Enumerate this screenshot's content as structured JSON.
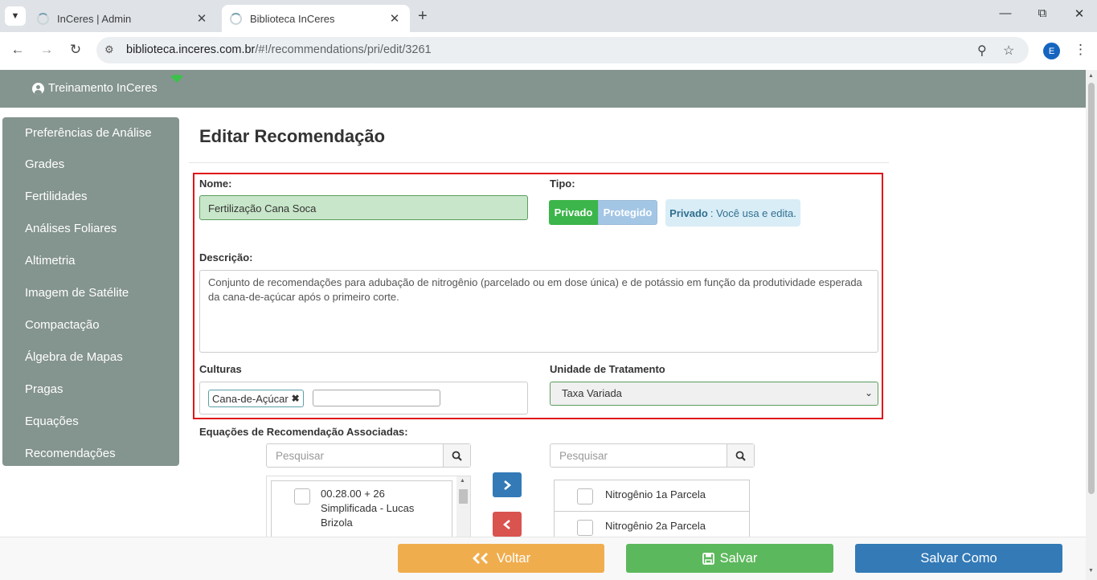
{
  "browser": {
    "tabs": [
      {
        "title": "InCeres | Admin",
        "active": false
      },
      {
        "title": "Biblioteca InCeres",
        "active": true
      }
    ],
    "url_host": "biblioteca.inceres.com.br",
    "url_path": "/#!/recommendations/pri/edit/3261",
    "profile_initial": "E"
  },
  "header": {
    "user_name": "Treinamento InCeres"
  },
  "sidebar": {
    "items": [
      {
        "label": "Preferências de Análise"
      },
      {
        "label": "Grades"
      },
      {
        "label": "Fertilidades"
      },
      {
        "label": "Análises Foliares"
      },
      {
        "label": "Altimetria"
      },
      {
        "label": "Imagem de Satélite"
      },
      {
        "label": "Compactação"
      },
      {
        "label": "Álgebra de Mapas"
      },
      {
        "label": "Pragas"
      },
      {
        "label": "Equações"
      },
      {
        "label": "Recomendações"
      }
    ]
  },
  "form": {
    "title": "Editar Recomendação",
    "name_label": "Nome:",
    "name_value": "Fertilização Cana Soca",
    "type_label": "Tipo:",
    "type_options": {
      "privado": "Privado",
      "protegido": "Protegido"
    },
    "type_info_bold": "Privado",
    "type_info_text": ": Você usa e edita.",
    "description_label": "Descrição:",
    "description_value": "Conjunto de recomendações para adubação de nitrogênio (parcelado ou em dose única) e de potássio em função da produtividade esperada da cana-de-açúcar após o primeiro corte.",
    "cultures_label": "Culturas",
    "culture_tag": "Cana-de-Açúcar",
    "treatment_label": "Unidade de Tratamento",
    "treatment_value": "Taxa Variada"
  },
  "equations": {
    "label": "Equações de Recomendação Associadas:",
    "left_search_placeholder": "Pesquisar",
    "right_search_placeholder": "Pesquisar",
    "left_items": [
      {
        "label": "00.28.00 + 26 Simplificada - Lucas Brizola"
      }
    ],
    "right_items": [
      {
        "label": "Nitrogênio 1a Parcela"
      },
      {
        "label": "Nitrogênio 2a Parcela"
      }
    ]
  },
  "footer": {
    "back_label": "Voltar",
    "save_label": "Salvar",
    "save_as_label": "Salvar Como"
  },
  "colors": {
    "sidebar_bg": "#84948e",
    "privado_green": "#3cb54a",
    "highlight_red": "#e0131a",
    "back_orange": "#f0ad4e",
    "save_green": "#5cb85c",
    "save_as_blue": "#337ab7",
    "move_right_blue": "#337ab7",
    "move_left_red": "#d9534f"
  }
}
